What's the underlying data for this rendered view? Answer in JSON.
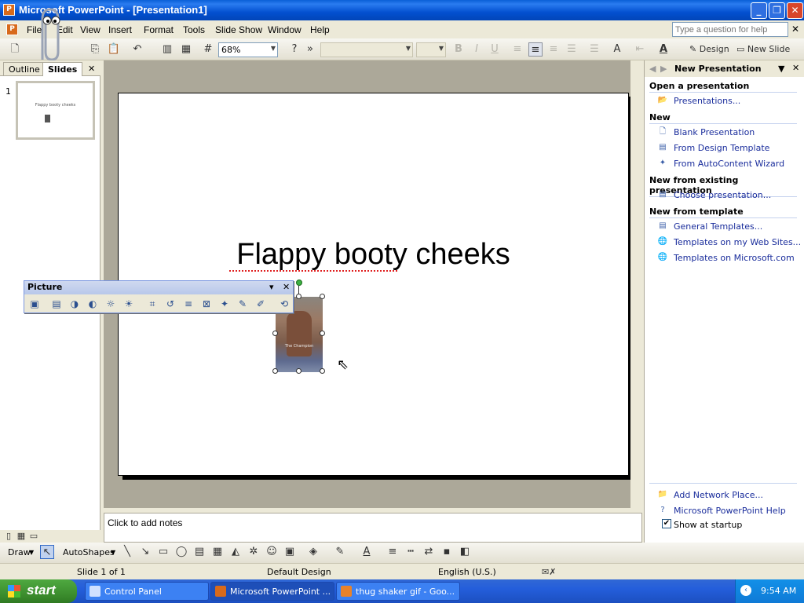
{
  "window": {
    "title": "Microsoft PowerPoint - [Presentation1]",
    "buttons": {
      "minimize": "_",
      "maximize": "❐",
      "close": "✕"
    }
  },
  "menu": {
    "items": [
      "File",
      "Edit",
      "View",
      "Insert",
      "Format",
      "Tools",
      "Slide Show",
      "Window",
      "Help"
    ],
    "help_placeholder": "Type a question for help"
  },
  "toolbar": {
    "zoom": "68%",
    "font": "",
    "size": "",
    "bold": "B",
    "italic": "I",
    "underline": "U",
    "design_label": "Design",
    "new_slide_label": "New Slide"
  },
  "left_pane": {
    "tabs": [
      "Outline",
      "Slides"
    ],
    "close": "✕",
    "slide_number": "1",
    "thumb_title": "Flappy booty cheeks"
  },
  "slide": {
    "title": "Flappy booty cheeks",
    "picture_caption": "The Champion"
  },
  "picture_toolbar": {
    "title": "Picture",
    "close": "✕"
  },
  "notes": {
    "placeholder": "Click to add notes"
  },
  "task_pane": {
    "title": "New Presentation",
    "sections": [
      {
        "heading": "Open a presentation",
        "links": [
          "Presentations..."
        ]
      },
      {
        "heading": "New",
        "links": [
          "Blank Presentation",
          "From Design Template",
          "From AutoContent Wizard"
        ]
      },
      {
        "heading": "New from existing presentation",
        "links": [
          "Choose presentation..."
        ]
      },
      {
        "heading": "New from template",
        "links": [
          "General Templates...",
          "Templates on my Web Sites...",
          "Templates on Microsoft.com"
        ]
      }
    ],
    "bottom_links": [
      "Add Network Place...",
      "Microsoft PowerPoint Help"
    ],
    "show_at_startup": "Show at startup",
    "show_at_startup_checked": true
  },
  "draw_toolbar": {
    "draw": "Draw",
    "autoshapes": "AutoShapes"
  },
  "status": {
    "slide": "Slide 1 of 1",
    "design": "Default Design",
    "language": "English (U.S.)"
  },
  "taskbar": {
    "start": "start",
    "tasks": [
      "Control Panel",
      "Microsoft PowerPoint ...",
      "thug shaker gif - Goo..."
    ],
    "clock": "9:54 AM"
  },
  "colors": {
    "titlebar": "#0a5fd6",
    "link": "#1a2d9c",
    "taskbar": "#245edb",
    "start": "#3d8f2f"
  }
}
